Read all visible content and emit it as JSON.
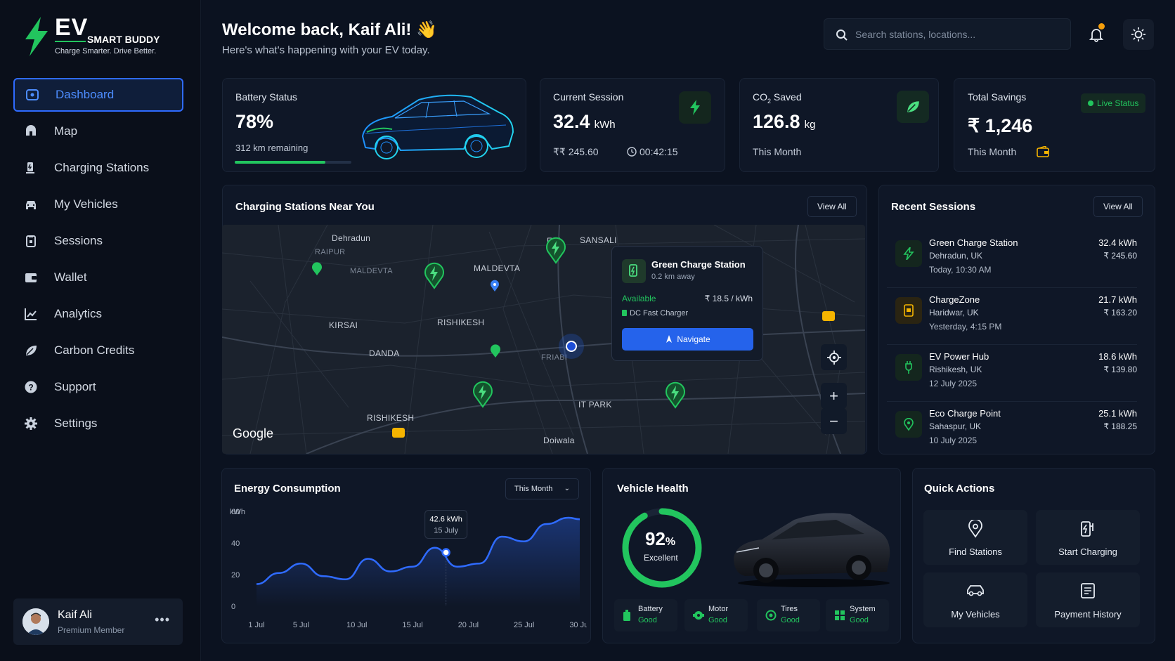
{
  "brand": {
    "title": "EV",
    "subtitle": "SMART BUDDY",
    "tagline": "Charge Smarter. Drive Better."
  },
  "nav": [
    {
      "label": "Dashboard",
      "icon": "dashboard-icon",
      "active": true
    },
    {
      "label": "Map",
      "icon": "map-icon"
    },
    {
      "label": "Charging Stations",
      "icon": "charging-station-icon"
    },
    {
      "label": "My Vehicles",
      "icon": "car-icon"
    },
    {
      "label": "Sessions",
      "icon": "clipboard-icon"
    },
    {
      "label": "Wallet",
      "icon": "wallet-icon"
    },
    {
      "label": "Analytics",
      "icon": "analytics-icon"
    },
    {
      "label": "Carbon Credits",
      "icon": "leaf-icon"
    },
    {
      "label": "Support",
      "icon": "help-icon"
    },
    {
      "label": "Settings",
      "icon": "gear-icon"
    }
  ],
  "user": {
    "name": "Kaif Ali",
    "role": "Premium Member",
    "more": "•••"
  },
  "header": {
    "title": "Welcome back, Kaif Ali! 👋",
    "subtitle": "Here's what's happening with your EV today.",
    "search_placeholder": "Search stations, locations..."
  },
  "battery": {
    "label": "Battery Status",
    "value": "78%",
    "remaining": "312 km remaining",
    "level": 0.78
  },
  "session": {
    "label": "Current Session",
    "value": "32.4",
    "unit": "kWh",
    "cost": "₹₹ 245.60",
    "time": "00:42:15"
  },
  "co2": {
    "label_main": "CO",
    "label_sub": "2",
    "label_tail": " Saved",
    "value": "126.8",
    "unit": "kg",
    "period": "This Month"
  },
  "savings": {
    "label": "Total Savings",
    "value": "₹ 1,246",
    "period": "This Month",
    "live": "Live Status"
  },
  "stations_card": {
    "title": "Charging Stations Near You",
    "view_all": "View All"
  },
  "map": {
    "towns": [
      "Dehradun",
      "RAIPUR",
      "MALDEVTA",
      "KIRSAI",
      "RISHIKESH",
      "DANDA",
      "FRI",
      "SANSALI",
      "MALDEVTA",
      "RISHIKESH",
      "IT PARK",
      "Doiwala",
      "FRIABI"
    ],
    "google": "Google",
    "popup": {
      "name": "Green Charge Station",
      "distance": "0.2 km away",
      "status": "Available",
      "price": "₹ 18.5 / kWh",
      "charger": "DC Fast Charger",
      "navigate": "Navigate"
    },
    "zoom_in": "+",
    "zoom_out": "−"
  },
  "recent": {
    "title": "Recent Sessions",
    "view_all": "View All",
    "items": [
      {
        "name": "Green Charge Station",
        "location": "Dehradun, UK",
        "time": "Today, 10:30 AM",
        "kwh": "32.4 kWh",
        "cost": "₹ 245.60",
        "color": "#22c55e"
      },
      {
        "name": "ChargeZone",
        "location": "Haridwar, UK",
        "time": "Yesterday, 4:15 PM",
        "kwh": "21.7 kWh",
        "cost": "₹ 163.20",
        "color": "#f5b400"
      },
      {
        "name": "EV Power Hub",
        "location": "Rishikesh, UK",
        "time": "12 July 2025",
        "kwh": "18.6 kWh",
        "cost": "₹ 139.80",
        "color": "#22c55e"
      },
      {
        "name": "Eco Charge Point",
        "location": "Sahaspur, UK",
        "time": "10 July 2025",
        "kwh": "25.1 kWh",
        "cost": "₹ 188.25",
        "color": "#22c55e"
      }
    ]
  },
  "energy": {
    "title": "Energy Consumption",
    "period": "This Month",
    "tooltip_value": "42.6 kWh",
    "tooltip_date": "15 July"
  },
  "chart_data": {
    "type": "line",
    "ylabel": "kWh",
    "ylim": [
      0,
      60
    ],
    "yticks": [
      0,
      20,
      40,
      60
    ],
    "xticks": [
      "1 Jul",
      "5 Jul",
      "10 Jul",
      "15 Jul",
      "20 Jul",
      "25 Jul",
      "30 Jul"
    ],
    "x": [
      1,
      3,
      5,
      7,
      9,
      11,
      13,
      15,
      17,
      19,
      21,
      23,
      25,
      27,
      29,
      30
    ],
    "values": [
      14,
      21,
      27,
      19,
      17,
      30,
      22,
      25,
      37,
      25,
      27,
      44,
      41,
      52,
      56,
      55
    ],
    "highlight": {
      "x": 18,
      "y": 34
    },
    "color": "#2f6bff"
  },
  "health": {
    "title": "Vehicle Health",
    "score": "92",
    "pct": "%",
    "status": "Excellent",
    "score_value": 92,
    "items": [
      {
        "name": "Battery",
        "status": "Good"
      },
      {
        "name": "Motor",
        "status": "Good"
      },
      {
        "name": "Tires",
        "status": "Good"
      },
      {
        "name": "System",
        "status": "Good"
      }
    ]
  },
  "quick": {
    "title": "Quick Actions",
    "items": [
      {
        "label": "Find Stations",
        "icon": "location-pin-icon"
      },
      {
        "label": "Start Charging",
        "icon": "charge-plug-icon"
      },
      {
        "label": "My Vehicles",
        "icon": "car-icon"
      },
      {
        "label": "Payment History",
        "icon": "receipt-icon"
      }
    ]
  },
  "colors": {
    "accent": "#2f6bff",
    "green": "#22c55e",
    "amber": "#f59e0b",
    "bg": "#0b1220"
  }
}
